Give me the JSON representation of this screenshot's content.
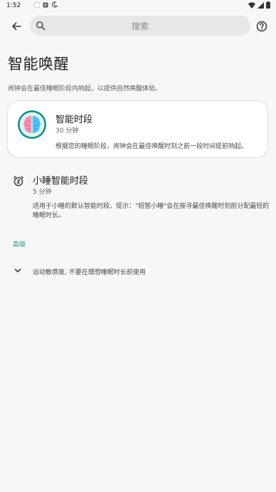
{
  "status_bar": {
    "time": "1:52",
    "icons_left": [
      "square-icon",
      "notification-icon",
      "moon-icon"
    ],
    "icons_right": [
      "wifi-icon",
      "signal-icon",
      "battery-icon"
    ]
  },
  "top_bar": {
    "back_icon": "arrow-left-icon",
    "search_placeholder": "搜索",
    "help_icon": "help-circle-icon"
  },
  "page": {
    "title": "智能唤醒",
    "subtitle": "闹钟会在最佳睡眠阶段内响起，以提供自然唤醒体验。"
  },
  "smart_window_card": {
    "icon": "brain-icon",
    "title": "智能时段",
    "value": "30 分钟",
    "description": "根据您的睡眠阶段，闹钟会在最佳唤醒时刻之前一段时间提前响起。"
  },
  "nap_item": {
    "icon": "alarm-clock-z-icon",
    "title": "小睡智能时段",
    "value": "5 分钟",
    "description": "适用于小睡的默认智能时段。提示：\"短暂小睡\"会在按寻最佳唤醒时刻前分配最短的睡眠时长。"
  },
  "advanced": {
    "section_label": "高级",
    "expand_icon": "chevron-down-icon",
    "expand_text": "运动敏感度, 不要在理想睡眠时长前使用"
  },
  "colors": {
    "accent": "#2a8c7a",
    "background": "#f7f7f7",
    "card": "#ffffff",
    "search_bg": "#e7e7e7"
  }
}
